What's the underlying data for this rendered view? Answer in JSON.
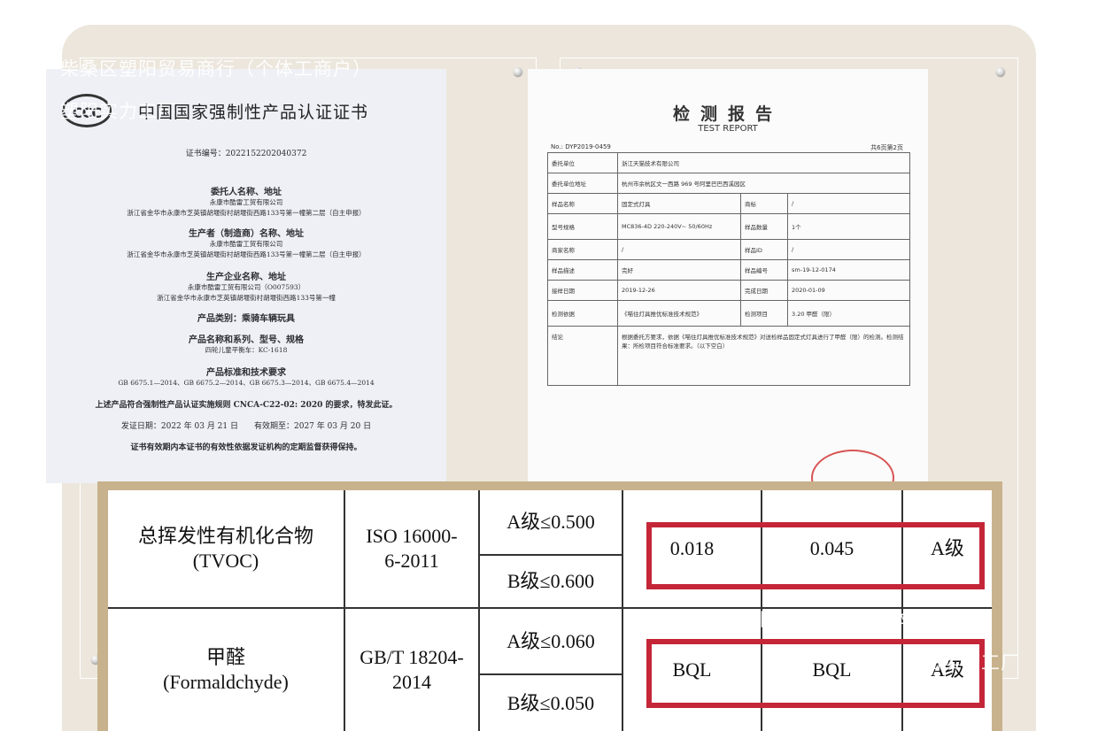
{
  "watermark": {
    "shop_name": "柴桑区塑阳贸易商行（个体工商户）",
    "factory_name": "塑阳实力工厂"
  },
  "certificate": {
    "logo_text": "CCC",
    "title": "中国国家强制性产品认证证书",
    "number": "证书编号：2022152202040372",
    "client_heading": "委托人名称、地址",
    "client_name": "永康市酷雷工贸有限公司",
    "client_address": "浙江省金华市永康市芝英镇胡堰街村胡堰街西路133号第一幢第二层（自主申报）",
    "producer_heading": "生产者（制造商）名称、地址",
    "producer_name": "永康市酷雷工贸有限公司",
    "producer_address": "浙江省金华市永康市芝英镇胡堰街村胡堰街西路133号第一幢第二层（自主申报）",
    "factory_heading": "生产企业名称、地址",
    "factory_name": "永康市酷雷工贸有限公司（O007593）",
    "factory_address": "浙江省金华市永康市芝英镇胡堰街村胡堰街西路133号第一幢",
    "category": "产品类别：乘骑车辆玩具",
    "model_heading": "产品名称和系列、型号、规格",
    "model": "四轮儿童平衡车：KC-1618",
    "standard_heading": "产品标准和技术要求",
    "standards": "GB 6675.1—2014、GB 6675.2—2014、GB 6675.3—2014、GB 6675.4—2014",
    "conformity": "上述产品符合强制性产品认证实施规则 CNCA-C22-02: 2020 的要求，特发此证。",
    "dates": "发证日期：2022 年 03 月 21 日　　有效期至：2027 年 03 月 20 日",
    "validity_note": "证书有效期内本证书的有效性依据发证机构的定期监督获得保持。"
  },
  "report": {
    "title": "检测报告",
    "subtitle": "TEST REPORT",
    "report_no": "No.: DYP2019-0459",
    "page_info": "共6页第2页",
    "rows": [
      [
        "委托单位",
        "浙江天猫技术有限公司",
        "",
        ""
      ],
      [
        "委托单位地址",
        "杭州市余杭区文一西路 969 号阿里巴巴西溪园区",
        "",
        ""
      ],
      [
        "样品名称",
        "固定式灯具",
        "商标",
        "/"
      ],
      [
        "型号规格",
        "MC836-4D 220-240V~ 50/60Hz",
        "样品数量",
        "1个"
      ],
      [
        "商家名称",
        "/",
        "样品ID",
        "/"
      ],
      [
        "样品描述",
        "完好",
        "样品编号",
        "sm-19-12-0174"
      ],
      [
        "接样日期",
        "2019-12-26",
        "完成日期",
        "2020-01-09"
      ],
      [
        "检测依据",
        "《喵住灯具推优标准技术规范》",
        "检测项目",
        "3.20 甲醛（限）"
      ]
    ],
    "note_label": "结论",
    "note_text": "根据委托方要求，依据《喵住灯具推优标准技术规范》对送检样品固定式灯具进行了甲醛（限）的检测。检测结果：所检项目符合标准要求。（以下空白）"
  },
  "comparison": {
    "rows": [
      {
        "name_cn": "总挥发性有机化合物",
        "name_en": "(TVOC)",
        "standard": "ISO 16000-6-2011",
        "limit_a": "A级≤0.500",
        "limit_b": "B级≤0.600",
        "value1": "0.018",
        "value2": "0.045",
        "grade": "A级"
      },
      {
        "name_cn": "甲醛",
        "name_en": "(Formaldchyde)",
        "standard": "GB/T 18204-2014",
        "limit_a": "A级≤0.060",
        "limit_b": "B级≤0.050",
        "value1": "BQL",
        "value2": "BQL",
        "grade": "A级"
      }
    ]
  },
  "colors": {
    "panel_bg": "#ece6dc",
    "table_border": "#c8b28d",
    "highlight_red": "#c42638",
    "stamp_red": "#d02a2a"
  }
}
